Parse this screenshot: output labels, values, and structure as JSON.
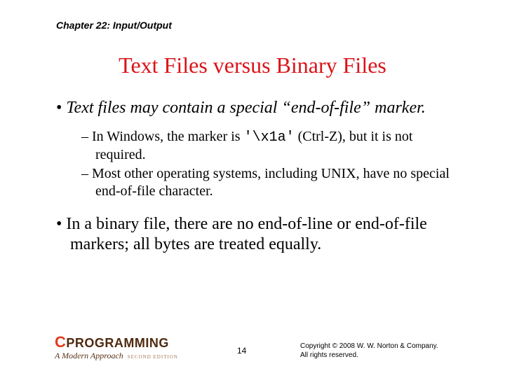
{
  "chapter": "Chapter 22: Input/Output",
  "title": "Text Files versus Binary Files",
  "bullet1": "Text files may contain a special “end-of-file” marker.",
  "sub1_pre": "In Windows, the marker is ",
  "sub1_code": "'\\x1a'",
  "sub1_post": " (Ctrl-Z), but it is not required.",
  "sub2": "Most other operating systems, including UNIX, have no special end-of-file character.",
  "bullet2": "In a binary file, there are no end-of-line or end-of-file markers; all bytes are treated equally.",
  "logo_c": "C",
  "logo_rest": "PROGRAMMING",
  "logo_sub": "A Modern Approach",
  "logo_edition": "SECOND EDITION",
  "page_number": "14",
  "copyright_line1": "Copyright © 2008 W. W. Norton & Company.",
  "copyright_line2": "All rights reserved."
}
